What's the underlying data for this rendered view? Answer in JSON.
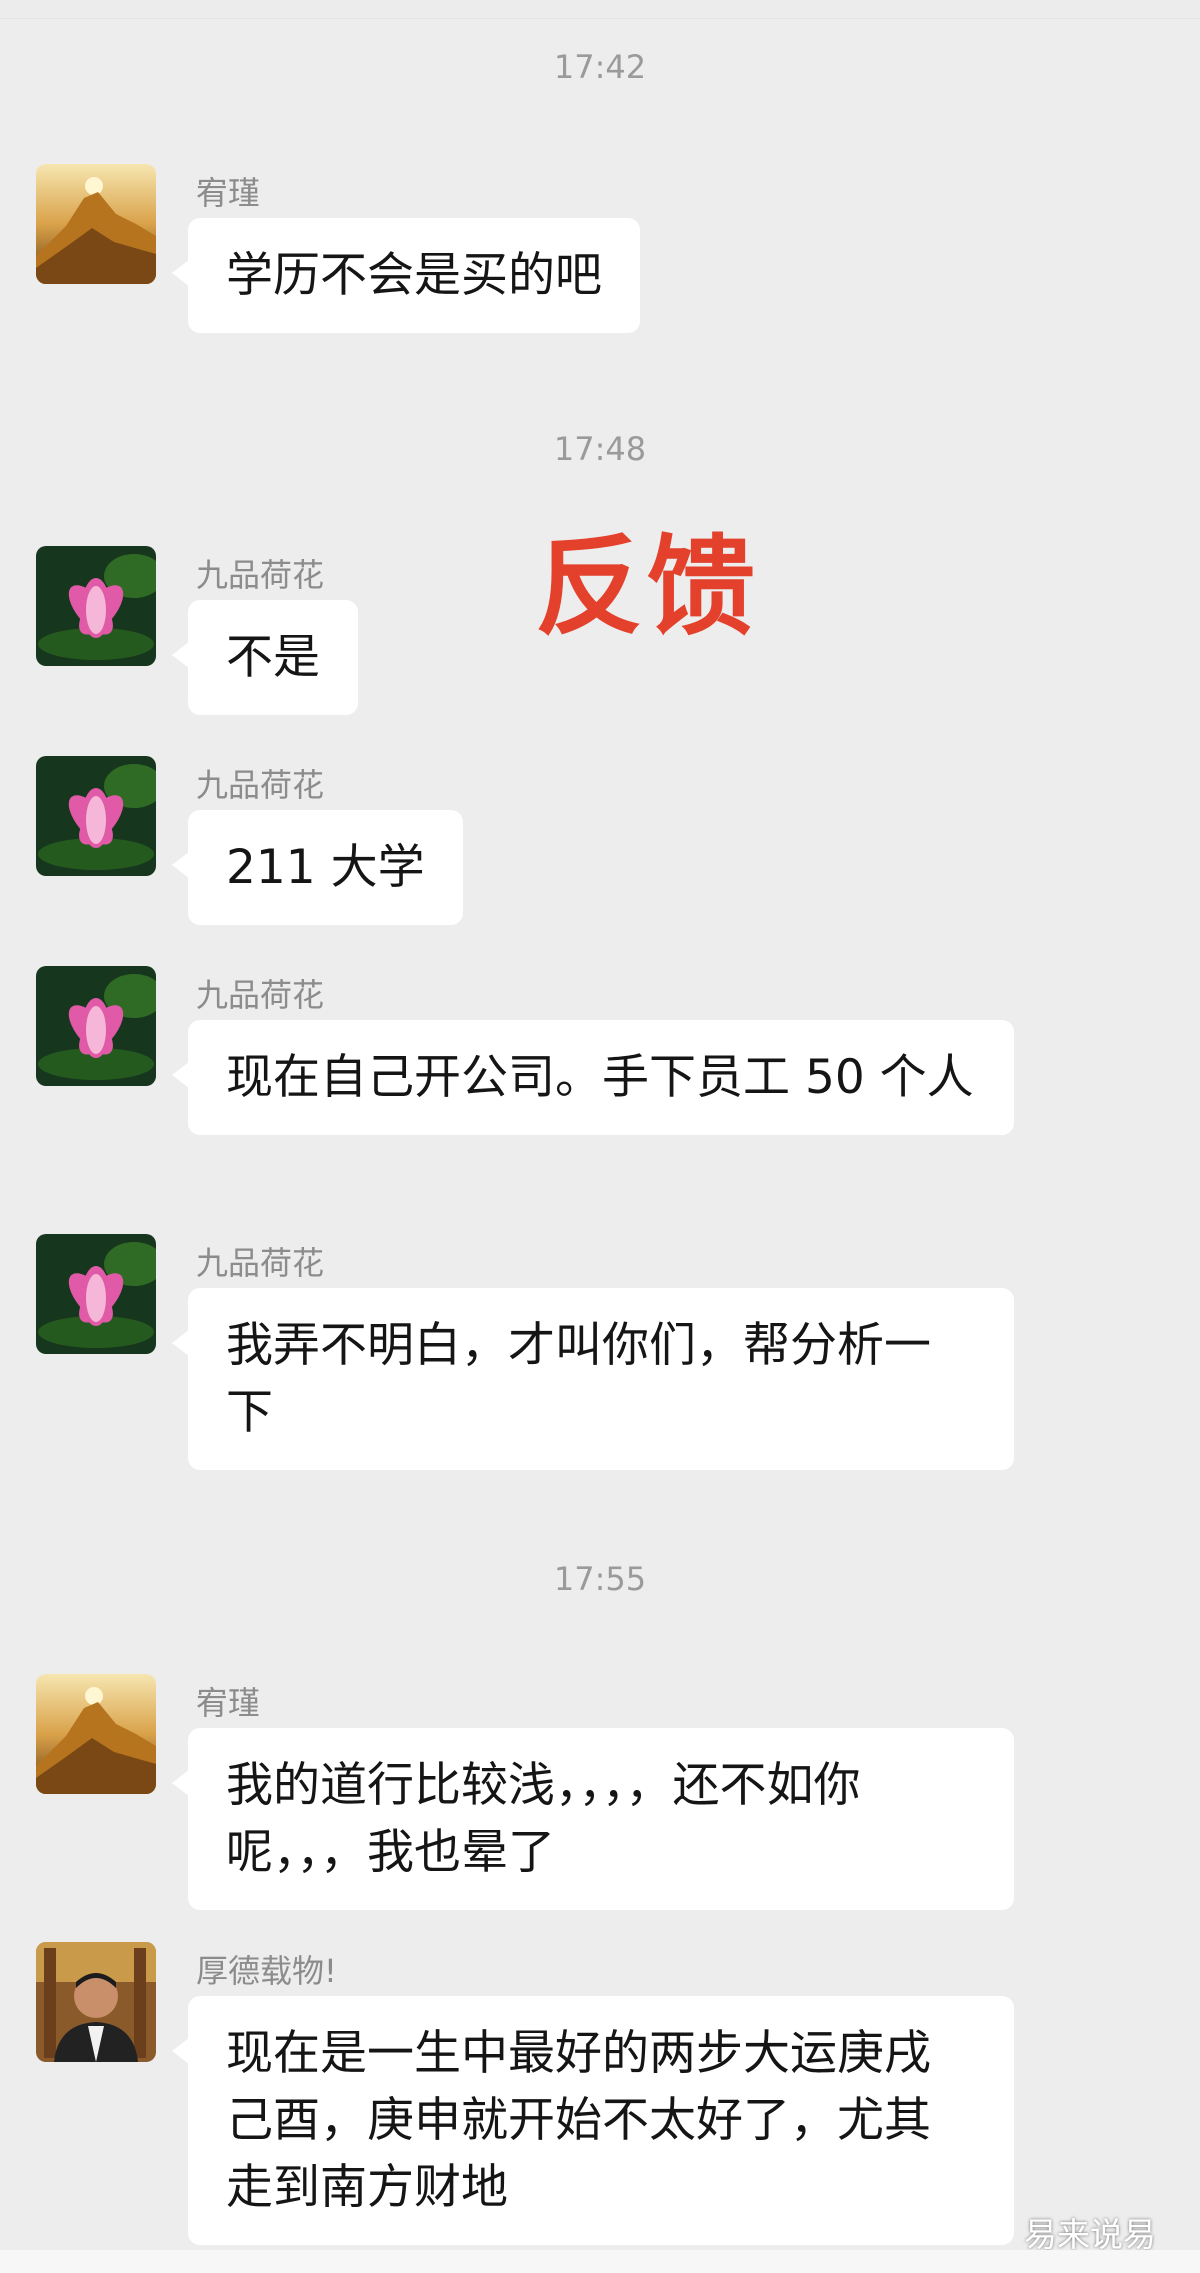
{
  "timestamps": [
    "17:42",
    "17:48",
    "17:55"
  ],
  "overlay_title": "反馈",
  "watermark": "易来说易",
  "messages": [
    {
      "sender": "宥瑾",
      "avatar": "golden-mountain-avatar",
      "text": "学历不会是买的吧"
    },
    {
      "sender": "九品荷花",
      "avatar": "lotus-flower-avatar",
      "text": "不是"
    },
    {
      "sender": "九品荷花",
      "avatar": "lotus-flower-avatar",
      "text": "211 大学"
    },
    {
      "sender": "九品荷花",
      "avatar": "lotus-flower-avatar",
      "text": "现在自己开公司。手下员工 50 个人"
    },
    {
      "sender": "九品荷花",
      "avatar": "lotus-flower-avatar",
      "text": "我弄不明白，才叫你们，帮分析一下"
    },
    {
      "sender": "宥瑾",
      "avatar": "golden-mountain-avatar",
      "text": "我的道行比较浅，，，，还不如你呢，，，我也晕了"
    },
    {
      "sender": "厚德载物!",
      "avatar": "man-photo-avatar",
      "text": "现在是一生中最好的两步大运庚戌己酉，庚申就开始不太好了，尤其走到南方财地"
    }
  ],
  "colors": {
    "background": "#ededed",
    "bubble": "#ffffff",
    "overlay_title": "#e4412d",
    "timestamp": "#9a9a9a"
  }
}
